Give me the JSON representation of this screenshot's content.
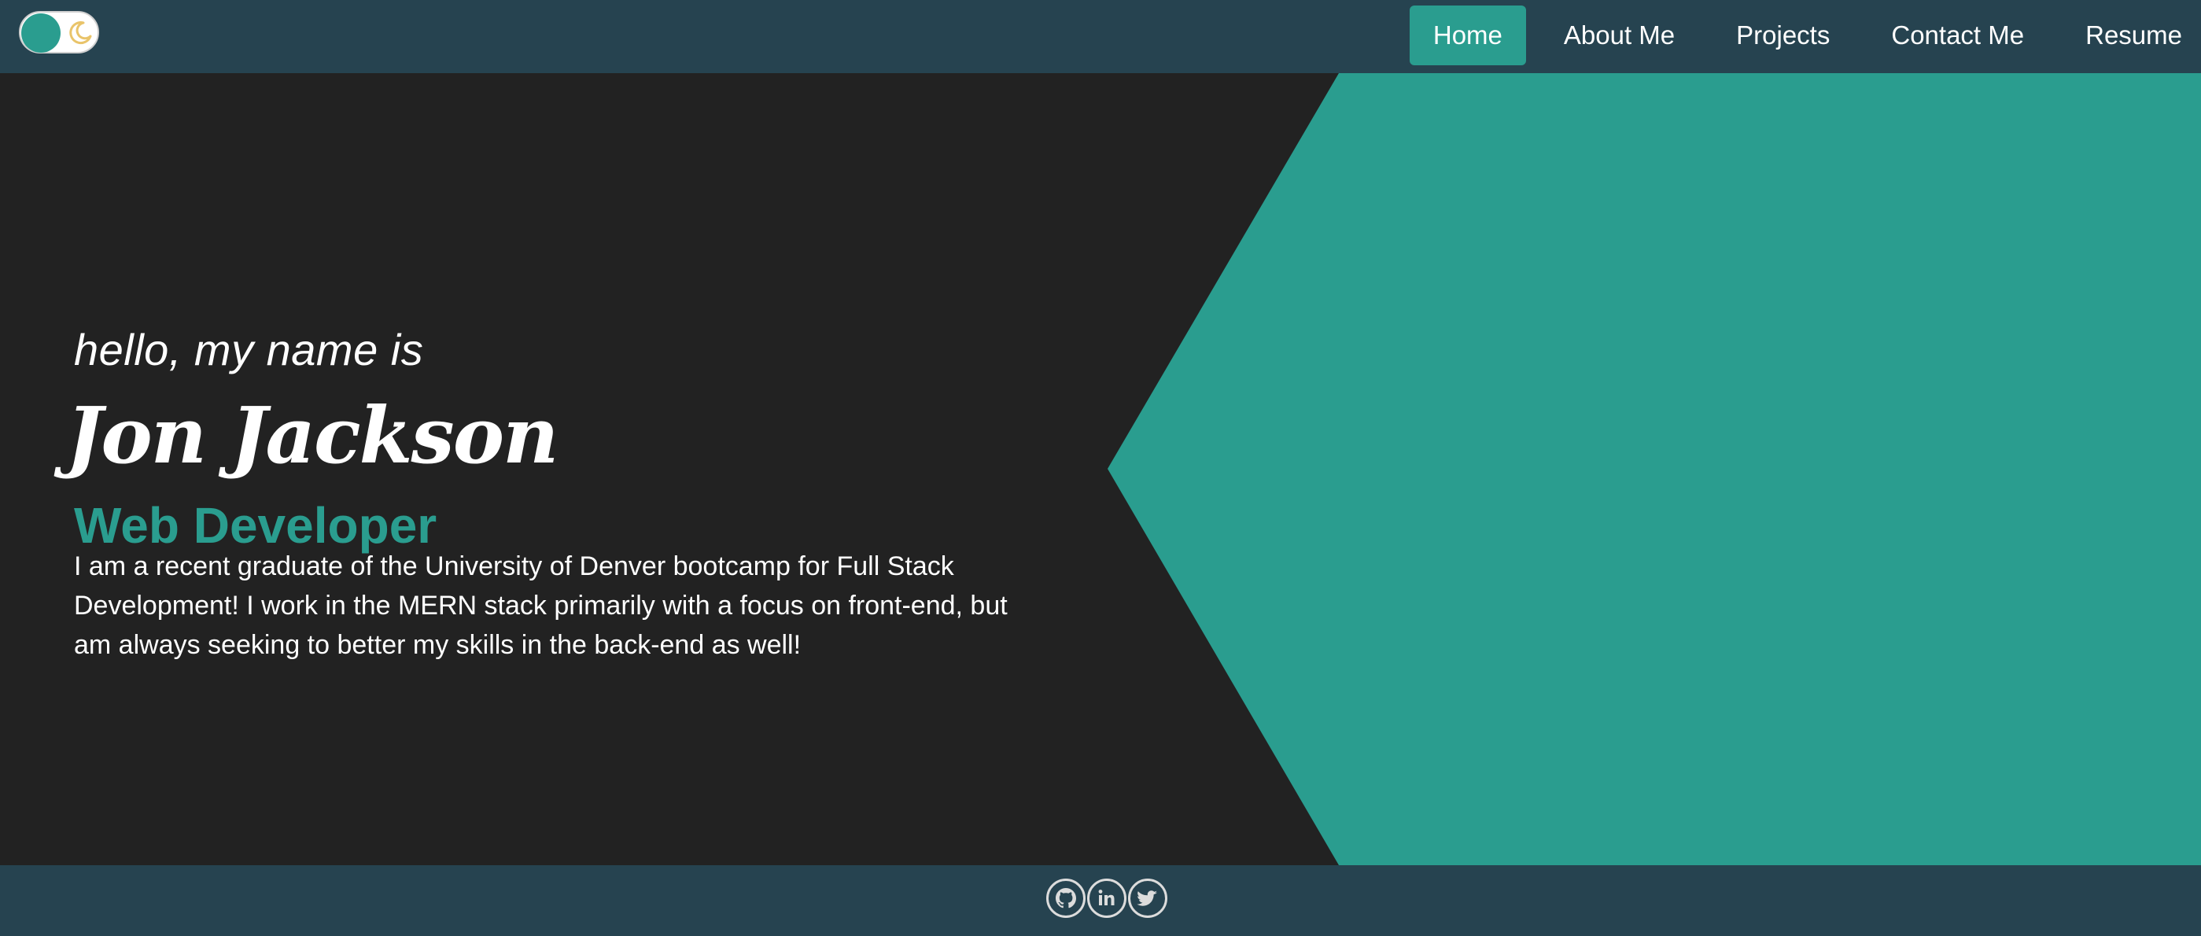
{
  "theme_toggle": {
    "icon": "moon-icon"
  },
  "nav": {
    "items": [
      {
        "label": "Home",
        "active": true
      },
      {
        "label": "About Me",
        "active": false
      },
      {
        "label": "Projects",
        "active": false
      },
      {
        "label": "Contact Me",
        "active": false
      },
      {
        "label": "Resume",
        "active": false
      }
    ]
  },
  "hero": {
    "greeting": "hello, my name is",
    "name": "Jon Jackson",
    "role": "Web Developer",
    "bio": "I am a recent graduate of the University of Denver bootcamp for Full Stack Development! I work in the MERN stack primarily with a focus on front-end, but am always seeking to better my skills in the back-end as well!"
  },
  "footer": {
    "social": [
      {
        "icon": "github-icon"
      },
      {
        "icon": "linkedin-icon"
      },
      {
        "icon": "twitter-icon"
      }
    ]
  },
  "colors": {
    "accent": "#2a9d8f",
    "background": "#222222",
    "navbar": "#264452"
  }
}
